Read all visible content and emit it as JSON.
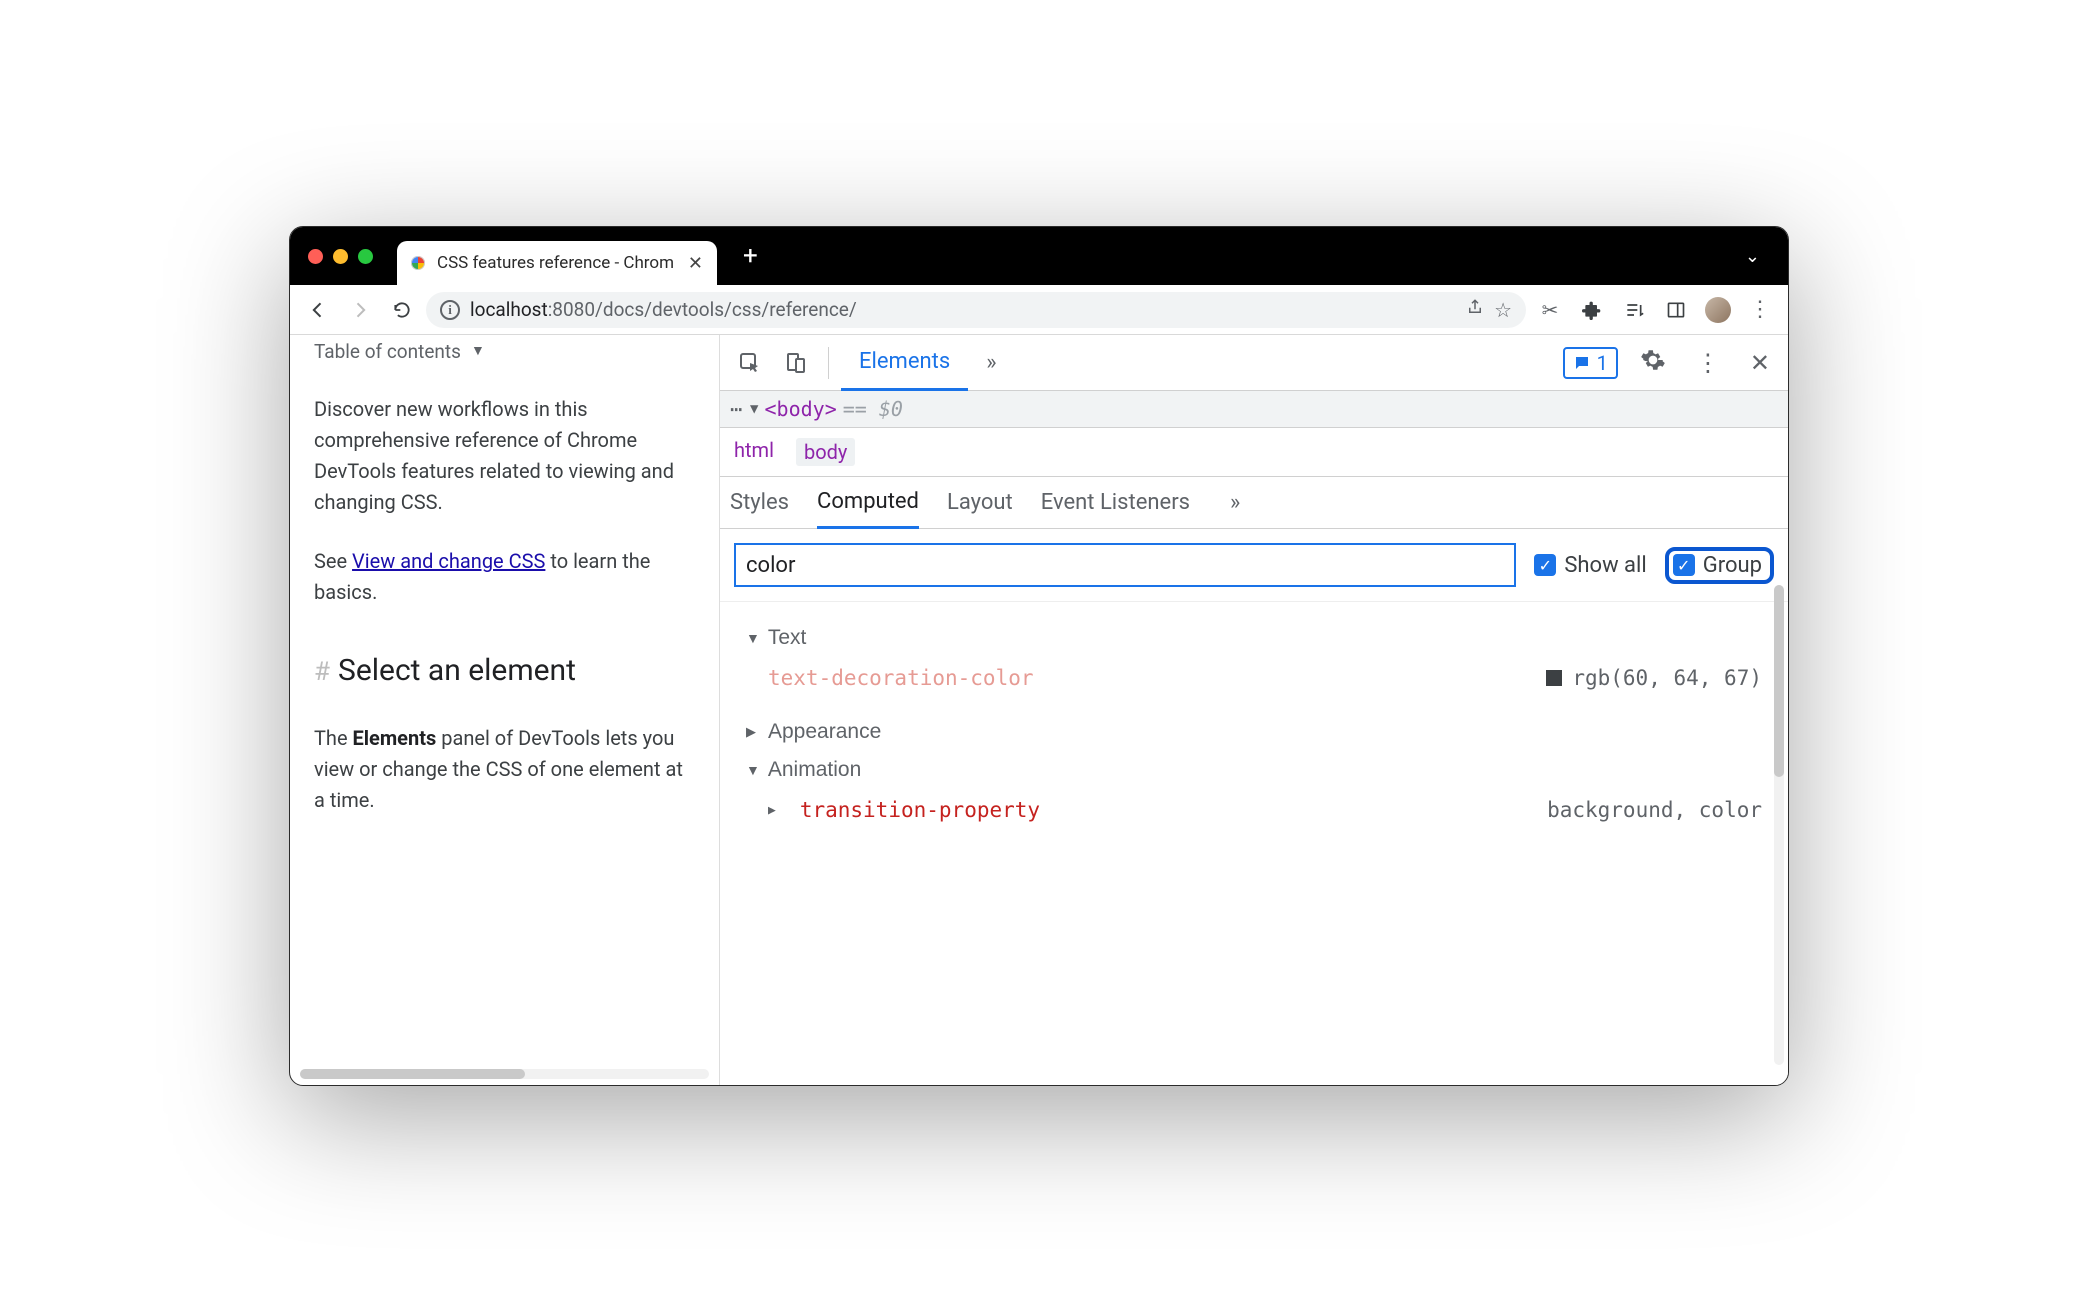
{
  "browser": {
    "tab_title": "CSS features reference - Chrom",
    "url_host": "localhost",
    "url_port": ":8080",
    "url_path": "/docs/devtools/css/reference/"
  },
  "page": {
    "toc_label": "Table of contents",
    "p1": "Discover new workflows in this comprehensive reference of Chrome DevTools features related to viewing and changing CSS.",
    "p2a": "See ",
    "p2_link": "View and change CSS",
    "p2b": " to learn the basics.",
    "h2": "Select an element",
    "p3a": "The ",
    "p3_bold": "Elements",
    "p3b": " panel of DevTools lets you view or change the CSS of one element at a time."
  },
  "devtools": {
    "tabs": {
      "elements": "Elements"
    },
    "msg_count": "1",
    "dom_tag": "<body>",
    "dom_eq": "== $0",
    "crumbs": [
      "html",
      "body"
    ],
    "subtabs": [
      "Styles",
      "Computed",
      "Layout",
      "Event Listeners"
    ],
    "filter_value": "color",
    "show_all_label": "Show all",
    "group_label": "Group",
    "groups": [
      {
        "name": "Text",
        "open": true,
        "props": [
          {
            "name": "text-decoration-color",
            "value": "rgb(60, 64, 67)",
            "swatch": true,
            "soft": true
          }
        ]
      },
      {
        "name": "Appearance",
        "open": false,
        "props": []
      },
      {
        "name": "Animation",
        "open": true,
        "props": [
          {
            "name": "transition-property",
            "value": "background, color",
            "collapsed": true
          }
        ]
      }
    ]
  }
}
